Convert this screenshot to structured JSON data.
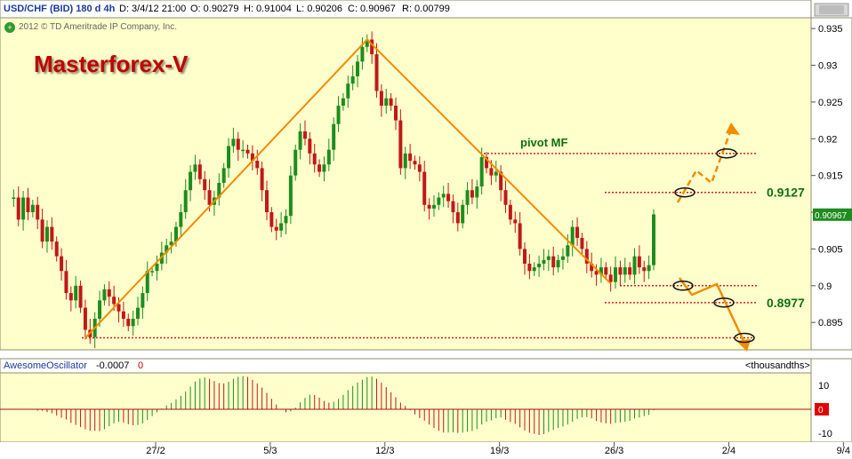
{
  "header": {
    "symbol": "USD/CHF (BID) 180 d 4h",
    "date": "D: 3/4/12 21:00",
    "open": "O: 0.90279",
    "high": "H: 0.91004",
    "low": "L: 0.90206",
    "close": "C: 0.90967",
    "range": "R: 0.00799",
    "copyright": "2012 © TD Ameritrade IP Company, Inc."
  },
  "brand": {
    "title": "Masterforex-V"
  },
  "colors": {
    "background": "#ffffcc",
    "up": "#1e8c1e",
    "down": "#c01818",
    "pattern": "#f08c00",
    "level": "#d02020",
    "annotation": "#107010",
    "brand": "#c00000"
  },
  "chart_data": {
    "type": "candlestick",
    "y_ticks": [
      "0.935",
      "0.93",
      "0.925",
      "0.92",
      "0.915",
      "0.91",
      "0.905",
      "0.9",
      "0.895"
    ],
    "ylim": [
      0.892,
      0.9355
    ],
    "x_ticks": [
      "27/2",
      "5/3",
      "12/3",
      "19/3",
      "26/3",
      "2/4",
      "9/4"
    ],
    "last_price": "0.90967",
    "last_price_value": 0.90967,
    "price_path": [
      0.912,
      0.912,
      0.909,
      0.912,
      0.91,
      0.911,
      0.909,
      0.906,
      0.908,
      0.906,
      0.904,
      0.902,
      0.899,
      0.898,
      0.9,
      0.897,
      0.894,
      0.893,
      0.8955,
      0.898,
      0.8995,
      0.8985,
      0.8975,
      0.8965,
      0.8955,
      0.8945,
      0.8955,
      0.897,
      0.899,
      0.902,
      0.902,
      0.903,
      0.9045,
      0.9055,
      0.906,
      0.908,
      0.91,
      0.913,
      0.9155,
      0.9165,
      0.9145,
      0.913,
      0.911,
      0.912,
      0.914,
      0.916,
      0.919,
      0.92,
      0.9185,
      0.9185,
      0.918,
      0.917,
      0.916,
      0.913,
      0.91,
      0.908,
      0.9075,
      0.9085,
      0.9095,
      0.915,
      0.9185,
      0.921,
      0.92,
      0.918,
      0.9165,
      0.9155,
      0.9165,
      0.9185,
      0.922,
      0.9245,
      0.9255,
      0.9275,
      0.9285,
      0.9305,
      0.9325,
      0.9335,
      0.9315,
      0.9265,
      0.9245,
      0.9255,
      0.9245,
      0.9225,
      0.916,
      0.918,
      0.917,
      0.9165,
      0.9155,
      0.911,
      0.9105,
      0.911,
      0.912,
      0.9125,
      0.9115,
      0.91,
      0.9085,
      0.911,
      0.913,
      0.912,
      0.9135,
      0.9175,
      0.916,
      0.915,
      0.9155,
      0.913,
      0.911,
      0.909,
      0.9085,
      0.905,
      0.903,
      0.902,
      0.9025,
      0.903,
      0.9035,
      0.904,
      0.9025,
      0.9035,
      0.904,
      0.9055,
      0.908,
      0.9065,
      0.905,
      0.903,
      0.902,
      0.9015,
      0.9025,
      0.9015,
      0.9005,
      0.9025,
      0.9015,
      0.9025,
      0.9015,
      0.904,
      0.9025,
      0.902,
      0.9028,
      0.9097
    ],
    "levels": [
      {
        "label": "pivot MF",
        "value": 0.918
      },
      {
        "label": "0.9127",
        "value": 0.9127
      },
      {
        "label": "",
        "value": 0.9
      },
      {
        "label": "0.8977",
        "value": 0.8977
      },
      {
        "label": "",
        "value": 0.8929
      }
    ],
    "oscillator": {
      "name": "AwesomeOscillator",
      "value": "-0.0007",
      "secondary_value": "0",
      "unit_label": "<thousandths>",
      "y_ticks": [
        "10",
        "0",
        "-10"
      ],
      "zero_badge": "0"
    }
  }
}
